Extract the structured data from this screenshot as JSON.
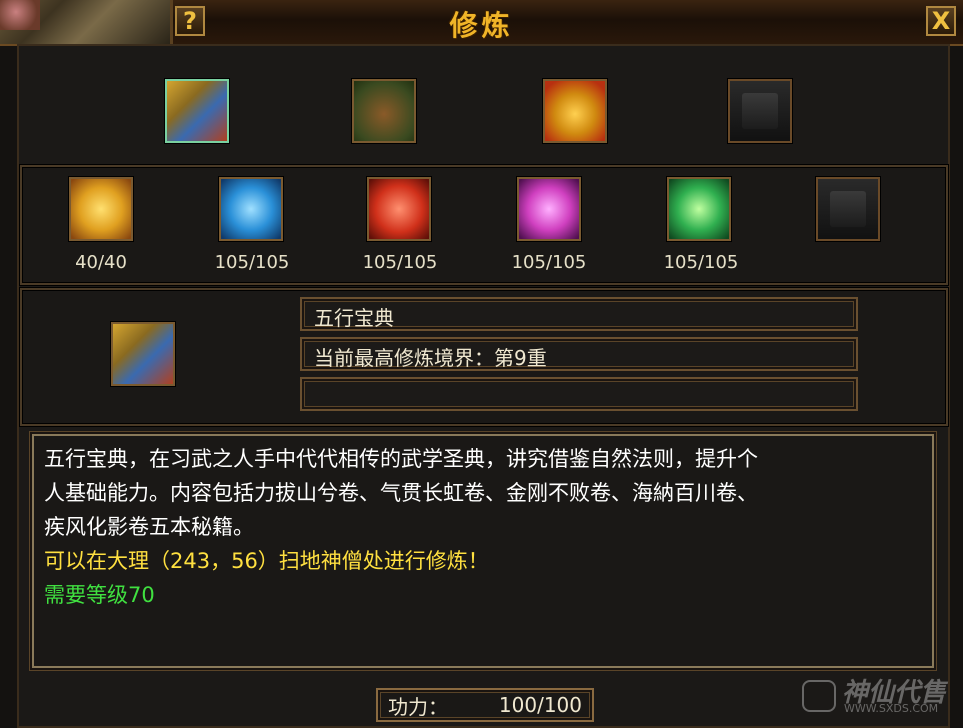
{
  "window": {
    "title": "修炼",
    "help_label": "?",
    "close_label": "X"
  },
  "top_slots": [
    {
      "icon": "book-icon",
      "selected": true
    },
    {
      "icon": "scroll-bundle-icon",
      "selected": false
    },
    {
      "icon": "gold-pile-icon",
      "selected": false
    },
    {
      "icon": "empty-slot",
      "selected": false
    }
  ],
  "books": [
    {
      "icon": "gold-book-icon",
      "count": "40/40"
    },
    {
      "icon": "blue-book-icon",
      "count": "105/105"
    },
    {
      "icon": "red-book-icon",
      "count": "105/105"
    },
    {
      "icon": "pink-book-icon",
      "count": "105/105"
    },
    {
      "icon": "green-book-icon",
      "count": "105/105"
    },
    {
      "icon": "empty-slot",
      "count": ""
    }
  ],
  "detail": {
    "name": "五行宝典",
    "realm": "当前最高修炼境界：第9重",
    "extra": ""
  },
  "description": {
    "line1": "五行宝典，在习武之人手中代代相传的武学圣典，讲究借鉴自然法则，提升个",
    "line2": "人基础能力。内容包括力拔山兮卷、气贯长虹卷、金刚不败卷、海納百川卷、",
    "line3": "疾风化影卷五本秘籍。",
    "location": "可以在大理（243，56）扫地神僧处进行修炼！",
    "requirement": "需要等级70"
  },
  "power": {
    "label": "功力：",
    "value": "100/100"
  },
  "watermark": {
    "text": "神仙代售",
    "url": "WWW.SXDS.COM"
  }
}
